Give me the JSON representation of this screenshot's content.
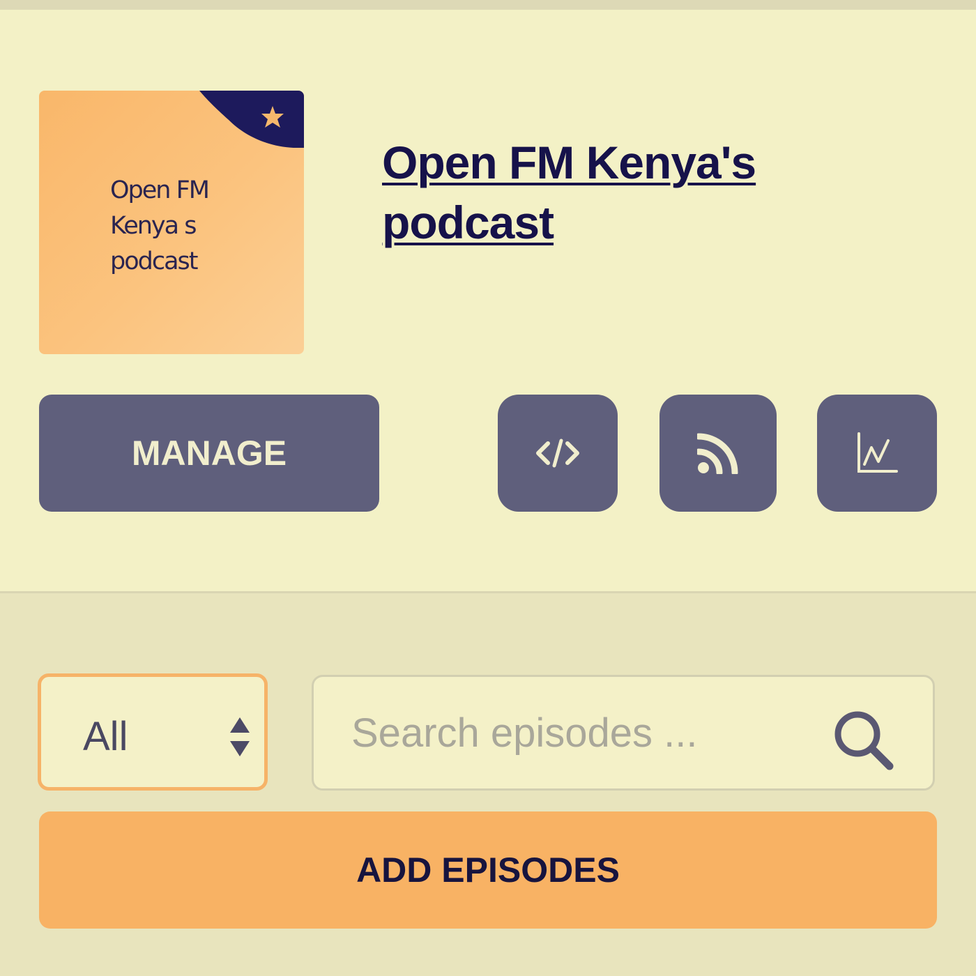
{
  "podcast": {
    "cover_text": "Open FM\nKenya s\npodcast",
    "title": "Open FM Kenya's podcast"
  },
  "actions": {
    "manage_label": "MANAGE",
    "icons": [
      "embed-code-icon",
      "rss-feed-icon",
      "stats-chart-icon"
    ]
  },
  "episodes": {
    "filter_selected": "All",
    "search_placeholder": "Search episodes ...",
    "add_label": "ADD EPISODES"
  },
  "colors": {
    "header_bg": "#f3f1c6",
    "page_bg": "#e8e4bd",
    "button_slate": "#5f5f7c",
    "accent_orange": "#f8b264",
    "navy": "#16124a"
  }
}
